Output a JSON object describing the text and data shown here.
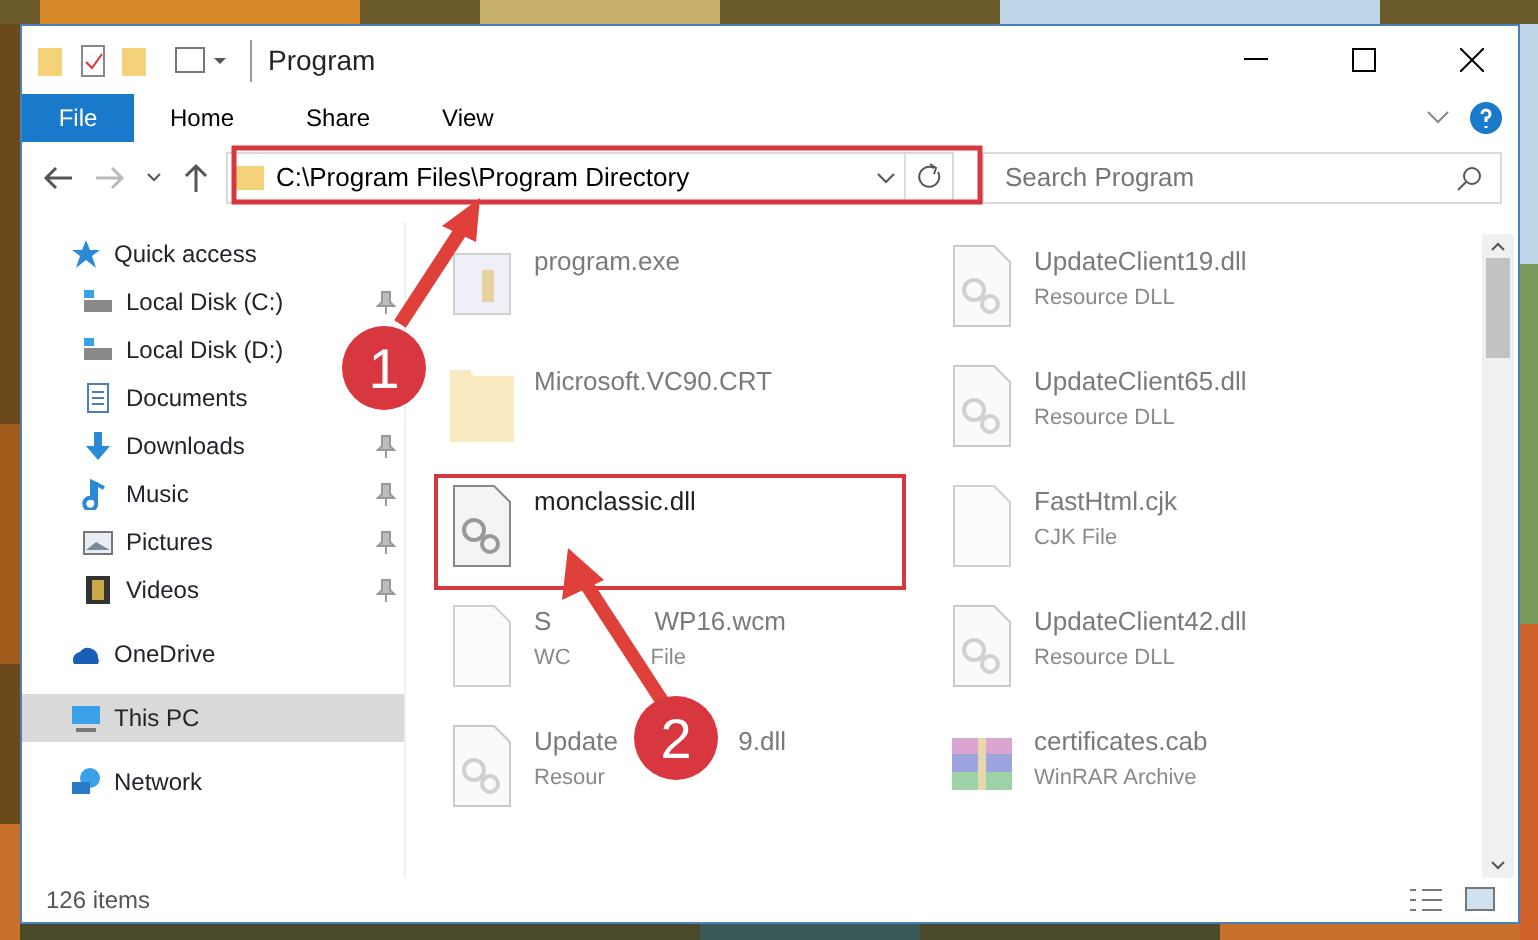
{
  "window": {
    "title": "Program"
  },
  "ribbon_tabs": [
    {
      "label": "File",
      "kind": "file",
      "selected": false
    },
    {
      "label": "Home",
      "kind": "tab",
      "selected": false
    },
    {
      "label": "Share",
      "kind": "tab",
      "selected": false
    },
    {
      "label": "View",
      "kind": "tab",
      "selected": false
    }
  ],
  "address_bar": {
    "value": "C:\\Program Files\\Program Directory"
  },
  "search": {
    "placeholder": "Search Program"
  },
  "sidebar": {
    "items": [
      {
        "label": "Quick access",
        "kind": "star",
        "selected": false,
        "children": [
          {
            "label": "Local Disk (C:)",
            "kind": "disk",
            "pinned": true,
            "selected": false
          },
          {
            "label": "Local Disk (D:)",
            "kind": "disk",
            "pinned": false,
            "selected": false
          },
          {
            "label": "Documents",
            "kind": "doc",
            "pinned": false,
            "selected": false
          },
          {
            "label": "Downloads",
            "kind": "download",
            "pinned": true,
            "selected": false
          },
          {
            "label": "Music",
            "kind": "music",
            "pinned": true,
            "selected": false
          },
          {
            "label": "Pictures",
            "kind": "pictures",
            "pinned": true,
            "selected": false
          },
          {
            "label": "Videos",
            "kind": "videos",
            "pinned": true,
            "selected": false
          }
        ]
      },
      {
        "label": "OneDrive",
        "kind": "cloud",
        "selected": false
      },
      {
        "label": "This PC",
        "kind": "pc",
        "selected": true
      },
      {
        "label": "Network",
        "kind": "network",
        "selected": false
      }
    ]
  },
  "files": [
    {
      "name": [
        "program.exe"
      ],
      "kind": "exe",
      "faded": true,
      "highlighted": false
    },
    {
      "name": [
        "UpdateClient19.dll"
      ],
      "type": [
        "Resource DLL"
      ],
      "kind": "dll",
      "faded": true,
      "highlighted": false
    },
    {
      "name": [
        "Microsoft.VC90.CRT"
      ],
      "kind": "folder",
      "faded": true,
      "highlighted": false
    },
    {
      "name": [
        "UpdateClient65.dll"
      ],
      "type": [
        "Resource DLL"
      ],
      "kind": "dll",
      "faded": true,
      "highlighted": false
    },
    {
      "name": [
        "monclassic.dll"
      ],
      "kind": "dll",
      "faded": false,
      "highlighted": true
    },
    {
      "name": [
        "FastHtml.cjk"
      ],
      "type": [
        "CJK File"
      ],
      "kind": "file",
      "faded": true,
      "highlighted": false
    },
    {
      "name": [
        "S",
        "WP16.wcm"
      ],
      "type": [
        "WC",
        "File"
      ],
      "kind": "file",
      "faded": true,
      "highlighted": false
    },
    {
      "name": [
        "UpdateClient42.dll"
      ],
      "type": [
        "Resource DLL"
      ],
      "kind": "dll",
      "faded": true,
      "highlighted": false
    },
    {
      "name": [
        "Update",
        "9.dll"
      ],
      "type": [
        "Resour"
      ],
      "kind": "dll",
      "faded": true,
      "highlighted": false
    },
    {
      "name": [
        "certificates.cab"
      ],
      "type": [
        "WinRAR Archive"
      ],
      "kind": "archive",
      "faded": true,
      "highlighted": false
    }
  ],
  "status_bar": {
    "text": "126 items"
  },
  "callouts": [
    {
      "number": "1"
    },
    {
      "number": "2"
    }
  ]
}
